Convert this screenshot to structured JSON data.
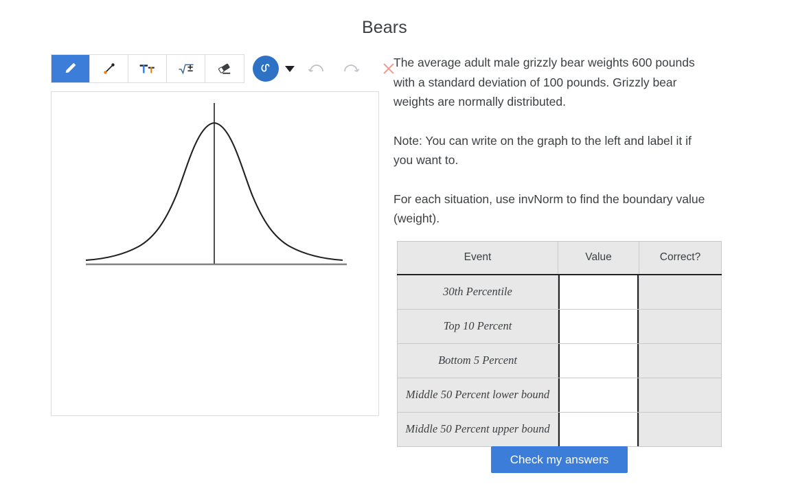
{
  "page": {
    "title": "Bears"
  },
  "toolbar": {
    "tools": [
      {
        "name": "pencil-tool",
        "icon": "pencil-icon",
        "active": true
      },
      {
        "name": "line-tool",
        "icon": "line-segment-icon",
        "active": false
      },
      {
        "name": "text-tool",
        "icon": "text-format-icon",
        "active": false
      },
      {
        "name": "math-tool",
        "icon": "square-root-plus-minus-icon",
        "active": false
      },
      {
        "name": "eraser-tool",
        "icon": "eraser-icon",
        "active": false
      }
    ],
    "stroke_style": {
      "name": "stroke-style-button",
      "icon": "squiggle-icon"
    },
    "stroke_dropdown": {
      "name": "stroke-style-dropdown",
      "icon": "chevron-down-icon"
    },
    "undo": {
      "name": "undo-button",
      "icon": "undo-arc-icon",
      "enabled": false
    },
    "redo": {
      "name": "redo-button",
      "icon": "redo-arc-icon",
      "enabled": false
    },
    "clear": {
      "name": "clear-button",
      "icon": "close-x-icon"
    }
  },
  "graph": {
    "description": "normal-distribution-bell-curve",
    "has_center_line": true,
    "baseline_color": "#808080",
    "curve_color": "#202124"
  },
  "prompt": {
    "paragraph1": "The average adult male grizzly bear weights 600 pounds with a standard deviation of 100 pounds. Grizzly bear weights are normally distributed.",
    "paragraph2": "Note:  You can write on the graph to the left and label it if you want to.",
    "paragraph3": "For each situation, use invNorm to find the boundary value (weight)."
  },
  "table": {
    "headers": [
      "Event",
      "Value",
      "Correct?"
    ],
    "rows": [
      {
        "event": "30th Percentile",
        "value": "",
        "correct": ""
      },
      {
        "event": "Top 10 Percent",
        "value": "",
        "correct": ""
      },
      {
        "event": "Bottom 5 Percent",
        "value": "",
        "correct": ""
      },
      {
        "event": "Middle 50 Percent lower bound",
        "value": "",
        "correct": ""
      },
      {
        "event": "Middle 50 Percent upper bound",
        "value": "",
        "correct": ""
      }
    ]
  },
  "actions": {
    "check_label": "Check my answers"
  },
  "colors": {
    "accent": "#3b7dd8",
    "stroke_circle": "#2d72c4",
    "clear_x": "#ef9a8b",
    "disabled_icon": "#bdc1c6",
    "table_bg": "#e8e8e8",
    "text": "#3c4043"
  }
}
